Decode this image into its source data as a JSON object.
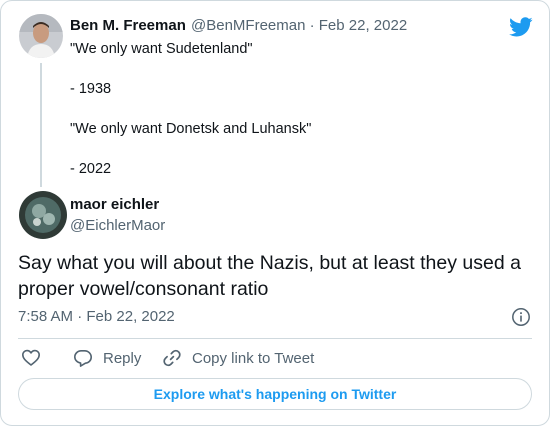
{
  "quoted_tweet": {
    "author_name": "Ben M. Freeman",
    "handle_date": "@BenMFreeman · Feb 22, 2022",
    "lines": [
      "\"We only want Sudetenland\"",
      "- 1938",
      "\"We only want Donetsk and Luhansk\"",
      "- 2022"
    ]
  },
  "tweet": {
    "author_name": "maor eichler",
    "handle": "@EichlerMaor",
    "text": "Say what you will about the Nazis, but at least they used a proper vowel/consonant ratio",
    "timestamp": "7:58 AM · Feb 22, 2022"
  },
  "actions": {
    "reply_label": "Reply",
    "copy_link_label": "Copy link to Tweet"
  },
  "explore_label": "Explore what's happening on Twitter",
  "icons": {
    "brand": "twitter-bird-icon",
    "info": "info-icon",
    "like": "heart-icon",
    "reply": "reply-bubble-icon",
    "link": "link-icon"
  },
  "colors": {
    "accent": "#1d9bf0",
    "text": "#0f1419",
    "muted": "#536471",
    "border": "#cfd9de"
  }
}
